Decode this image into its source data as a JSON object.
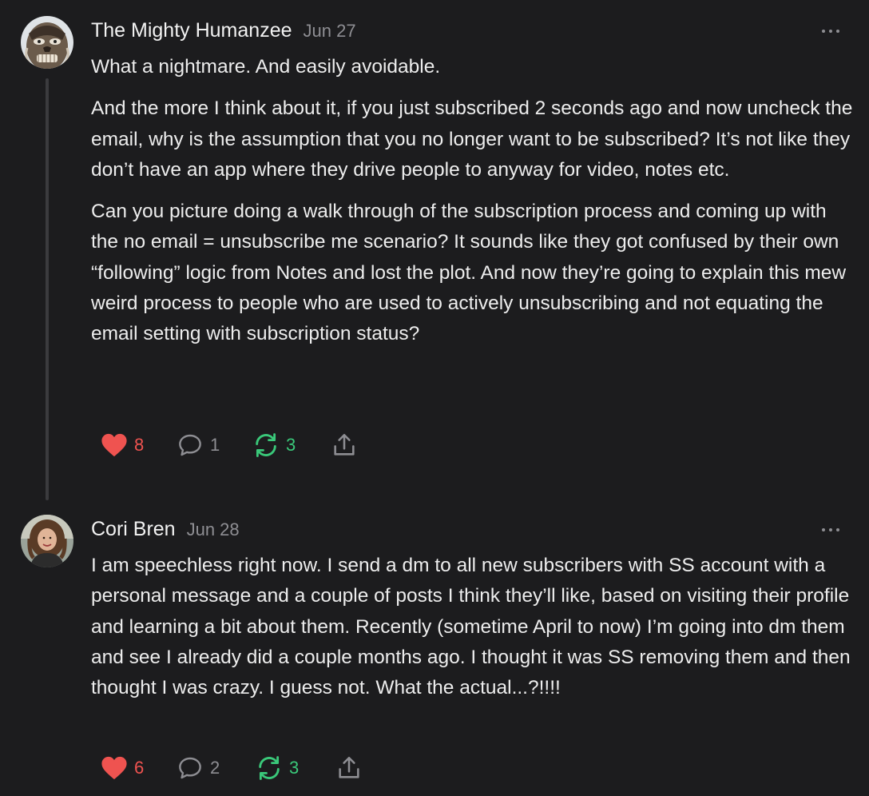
{
  "comments": [
    {
      "author": "The Mighty Humanzee",
      "date": "Jun 27",
      "avatar_icon": "gorilla-mask-avatar",
      "paragraphs": [
        "What a nightmare. And easily avoidable.",
        "And the more I think about it, if you just subscribed 2 seconds ago and now uncheck the email, why is the assumption that you no longer want to be subscribed? It’s not like they don’t have an app where they drive people to anyway for video, notes etc.",
        "Can you picture doing a walk through of the subscription process and coming up with the no email = unsubscribe me scenario? It sounds like they got confused by their own “following” logic from Notes and lost the plot. And now they’re going to explain this mew weird process to people who are used to actively unsubscribing and not equating the email setting with subscription status?"
      ],
      "likes": "8",
      "replies": "1",
      "restacks": "3"
    },
    {
      "author": "Cori Bren",
      "date": "Jun 28",
      "avatar_icon": "woman-portrait-avatar",
      "paragraphs": [
        "I am speechless right now. I send a dm to all new subscribers with SS account with a personal message and a couple of posts I think they’ll like, based on visiting their profile and learning a bit about them. Recently (sometime April to now) I’m going into dm them and see I already did a couple months ago. I thought it was SS removing them and then thought I was crazy. I guess not. What the actual...?!!!!"
      ],
      "likes": "6",
      "replies": "2",
      "restacks": "3"
    }
  ],
  "colors": {
    "background": "#1c1c1e",
    "like": "#ef5350",
    "restack": "#3ac97a",
    "muted": "#8e8e93",
    "text": "#ededed"
  },
  "icons": [
    "heart-icon",
    "comment-bubble-icon",
    "restack-icon",
    "share-icon",
    "more-options-icon"
  ]
}
